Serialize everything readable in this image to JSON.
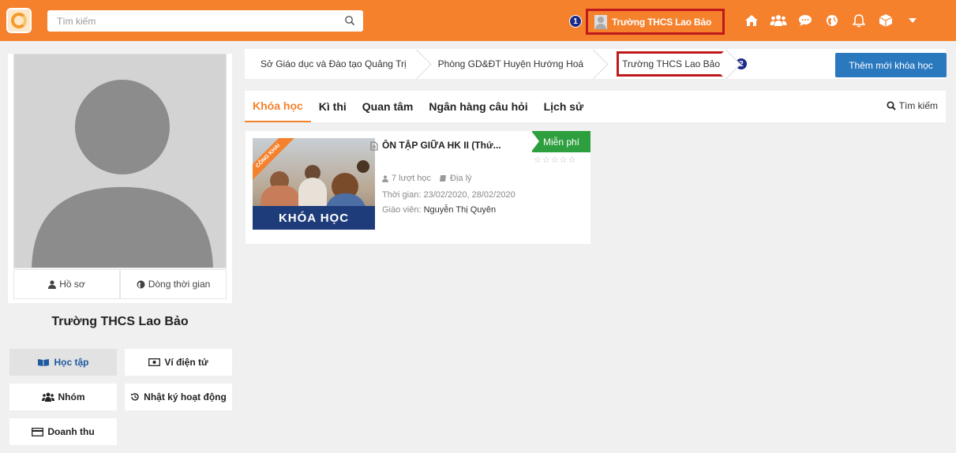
{
  "header": {
    "search_placeholder": "Tìm kiếm",
    "user_name": "Trường THCS Lao Bảo",
    "marker_1": "1",
    "icons": [
      "home-icon",
      "group-icon",
      "chat-icon",
      "globe-icon",
      "bell-icon",
      "box-icon",
      "caret-down-icon"
    ],
    "accent_color": "#f5812d"
  },
  "profile": {
    "tabs": {
      "profile": "Hồ sơ",
      "timeline": "Dòng thời gian"
    },
    "name": "Trường THCS Lao Bảo"
  },
  "menu": {
    "study": "Học tập",
    "wallet": "Ví điện tử",
    "groups": "Nhóm",
    "activity_log": "Nhật ký hoạt động",
    "revenue": "Doanh thu"
  },
  "breadcrumb": {
    "items": [
      "Sở Giáo dục và Đào tạo Quảng Trị",
      "Phòng GD&ĐT Huyện Hướng Hoá",
      "Trường THCS Lao Bảo"
    ],
    "marker_2": "2"
  },
  "actions": {
    "add_course": "Thêm mới khóa học"
  },
  "tabs": {
    "items": [
      "Khóa học",
      "Kì thi",
      "Quan tâm",
      "Ngân hàng câu hỏi",
      "Lịch sử"
    ],
    "search": "Tìm kiếm"
  },
  "course": {
    "ribbon": "CÔNG KHAI",
    "band": "KHÓA HỌC",
    "title": "ÔN TẬP GIỮA HK II (Thứ...",
    "price": "Miễn phí",
    "stars": "☆☆☆☆☆",
    "learners": "7 lượt học",
    "subject": "Địa lý",
    "time_label": "Thời gian:",
    "time_value": "23/02/2020, 28/02/2020",
    "teacher_label": "Giáo viên:",
    "teacher_value": "Nguyễn Thị Quyên"
  }
}
